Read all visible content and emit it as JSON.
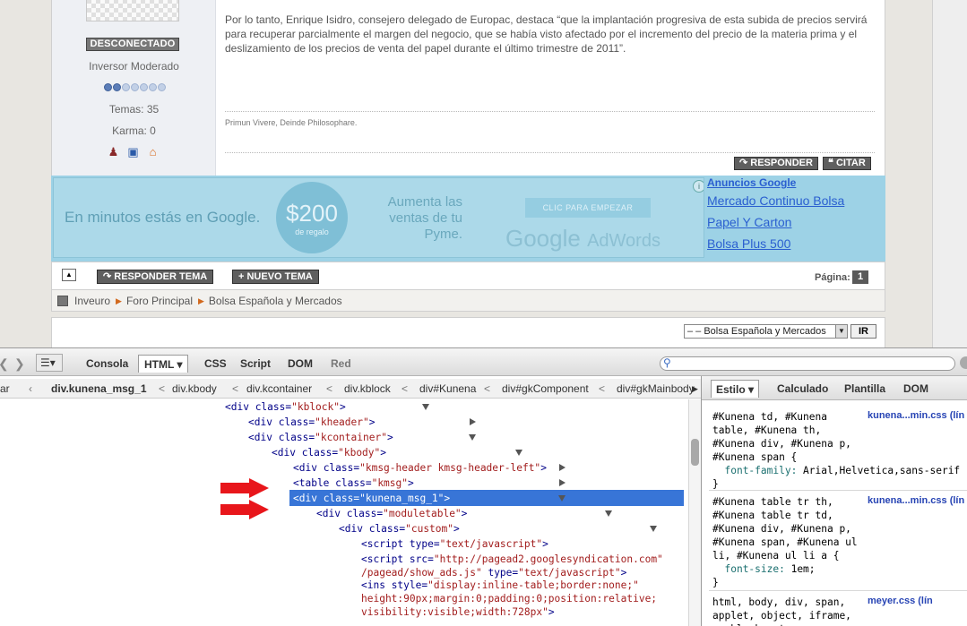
{
  "forum": {
    "user": {
      "status_badge": "DESCONECTADO",
      "rank": "Inversor Moderado",
      "rank_level": 2,
      "rank_max": 7,
      "topics": "Temas: 35",
      "karma": "Karma: 0"
    },
    "post_body": "Por lo tanto, Enrique Isidro, consejero delegado de Europac, destaca “que la implantación progresiva de esta subida de precios servirá para recuperar parcialmente el margen del negocio, que se había visto afectado por el incremento del precio de la materia prima y el deslizamiento de los precios de venta del papel durante el último trimestre de 2011”.",
    "signature": "Primun Vivere, Deinde Philosophare.",
    "reply_button": "RESPONDER",
    "quote_button": "CITAR",
    "ad": {
      "left_text": "En minutos estás en Google.",
      "amount": "$200",
      "amount_sub": "de regalo",
      "mid_text": "Aumenta las ventas de tu Pyme.",
      "cta": "CLIC PARA EMPEZAR",
      "logo": "Google",
      "logo_sub": "AdWords",
      "side_title": "Anuncios Google",
      "side_links": [
        "Mercado Continuo Bolsa",
        "Papel Y Carton",
        "Bolsa Plus 500"
      ]
    },
    "toolbar": {
      "reply_topic": "RESPONDER TEMA",
      "new_topic": "NUEVO TEMA",
      "page_label": "Página:",
      "page_num": "1"
    },
    "breadcrumb": [
      "Inveuro",
      "Foro Principal",
      "Bolsa Española y Mercados"
    ],
    "jump": {
      "selected": "– – Bolsa Española y Mercados",
      "go": "IR"
    }
  },
  "firebug": {
    "tabs": [
      "Consola",
      "HTML",
      "CSS",
      "Script",
      "DOM",
      "Red"
    ],
    "active_tab": "HTML",
    "breadcrumbs": [
      "ar",
      "div.kunena_msg_1",
      "div.kbody",
      "div.kcontainer",
      "div.kblock",
      "div#Kunena",
      "div#gkComponent",
      "div#gkMainbody"
    ],
    "side_tabs": [
      "Estilo",
      "Calculado",
      "Plantilla",
      "DOM"
    ],
    "tree": [
      {
        "tag": "div",
        "attr": "class",
        "val": "kblock",
        "state": "open"
      },
      {
        "tag": "div",
        "attr": "class",
        "val": "kheader",
        "state": "closed"
      },
      {
        "tag": "div",
        "attr": "class",
        "val": "kcontainer",
        "state": "open"
      },
      {
        "tag": "div",
        "attr": "class",
        "val": "kbody",
        "state": "open"
      },
      {
        "tag": "div",
        "attr": "class",
        "val": "kmsg-header kmsg-header-left",
        "state": "closed"
      },
      {
        "tag": "table",
        "attr": "class",
        "val": "kmsg",
        "state": "closed"
      },
      {
        "tag": "div",
        "attr": "class",
        "val": "kunena_msg_1",
        "state": "open"
      },
      {
        "tag": "div",
        "attr": "class",
        "val": "moduletable",
        "state": "open"
      },
      {
        "tag": "div",
        "attr": "class",
        "val": "custom",
        "state": "open"
      },
      {
        "tag": "script",
        "attr": "type",
        "val": "text/javascript",
        "state": "closed"
      },
      {
        "tag": "script",
        "attr": "src",
        "val": "http://pagead2.googlesyndication.com",
        "val2": "/pagead/show_ads.js",
        "attr2": "type",
        "val3": "text/javascript",
        "state": "closed"
      },
      {
        "tag": "ins",
        "attr": "style",
        "val": "display:inline-table;border:none;",
        "val2": "height:90px;margin:0;padding:0;position:relative;",
        "val3": "visibility:visible;width:728px",
        "state": "closed"
      }
    ],
    "css_rules": [
      {
        "selector": "#Kunena td, #Kunena\ntable, #Kunena th,\n#Kunena div, #Kunena p,\n#Kunena span {",
        "prop": "font-family",
        "value": "Arial,Helvetica,sans-serif",
        "source": "kunena...min.css (lín"
      },
      {
        "selector": "#Kunena table tr th,\n#Kunena table tr td,\n#Kunena div, #Kunena p,\n#Kunena span, #Kunena ul\nli, #Kunena ul li a {",
        "prop": "font-size",
        "value": "1em;",
        "source": "kunena...min.css (lín"
      },
      {
        "selector": "html, body, div, span,\napplet, object, iframe,\np, blockquote, pre, a,",
        "source": "meyer.css (lín"
      }
    ]
  }
}
